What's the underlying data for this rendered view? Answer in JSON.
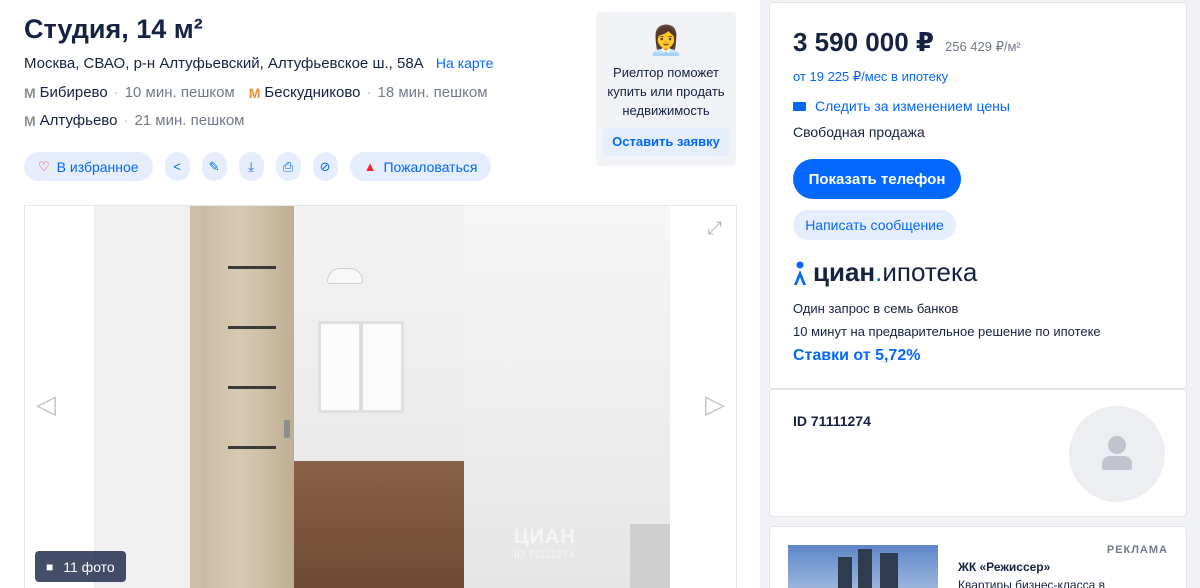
{
  "listing": {
    "title": "Студия, 14 м²",
    "address": "Москва, СВАО, р-н Алтуфьевский, Алтуфьевское ш., 58А",
    "map_link": "На карте"
  },
  "metro": [
    {
      "icon": "metro-icon",
      "color": "#8d8e92",
      "name": "Бибирево",
      "walk": "10 мин. пешком"
    },
    {
      "icon": "metro-icon",
      "color": "#e8913a",
      "name": "Бескудниково",
      "walk": "18 мин. пешком"
    },
    {
      "icon": "metro-icon",
      "color": "#8d8e92",
      "name": "Алтуфьево",
      "walk": "21 мин. пешком"
    }
  ],
  "actions": {
    "favorite": "В избранное",
    "complain": "Пожаловаться"
  },
  "realtor": {
    "text": "Риелтор поможет купить или продать недвижимость",
    "button": "Оставить заявку"
  },
  "gallery": {
    "photo_count": "11 фото",
    "watermark": "ЦИАН",
    "watermark_id": "ID 71111274"
  },
  "pricing": {
    "price": "3 590 000 ₽",
    "price_per_m2": "256 429 ₽/м²",
    "mortgage": "от 19 225 ₽/мес в ипотеку",
    "follow": "Следить за изменением цены",
    "sale_type": "Свободная продажа",
    "phone_button": "Показать телефон",
    "message_button": "Написать сообщение"
  },
  "promo": {
    "logo_cian": "циан",
    "logo_dot": ".",
    "logo_ipoteka": "ипотека",
    "line1": "Один запрос в семь банков",
    "line2": "10 минут на предварительное решение по ипотеке",
    "rates": "Ставки от 5,72%"
  },
  "agent": {
    "id": "ID 71111274"
  },
  "ad": {
    "label": "РЕКЛАМА",
    "title": "ЖК «Режиссер»",
    "subtitle": "Квартиры бизнес-класса в"
  },
  "colors": {
    "accent": "#0468ff",
    "accent_light": "#e6eefe",
    "text": "#152242",
    "muted": "#737a8e",
    "danger": "#ff1f34"
  }
}
